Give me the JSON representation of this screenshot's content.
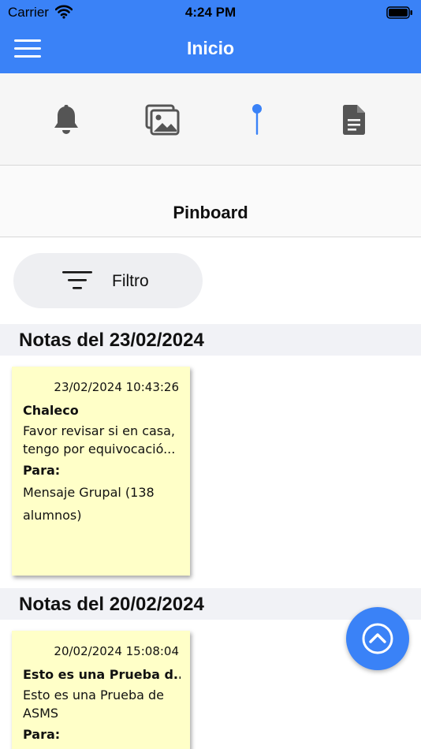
{
  "status_bar": {
    "carrier": "Carrier",
    "time": "4:24 PM",
    "wifi_icon": "wifi-icon",
    "battery_icon": "battery-icon"
  },
  "nav": {
    "title": "Inicio",
    "menu_icon": "hamburger-menu-icon",
    "color": "#3a82f7"
  },
  "tabs": [
    {
      "icon": "bell-icon",
      "active": false
    },
    {
      "icon": "gallery-icon",
      "active": false
    },
    {
      "icon": "pin-icon",
      "active": true
    },
    {
      "icon": "document-icon",
      "active": false
    }
  ],
  "section": {
    "title": "Pinboard"
  },
  "filter": {
    "label": "Filtro",
    "icon": "filter-icon"
  },
  "groups": [
    {
      "header": "Notas del 23/02/2024",
      "notes": [
        {
          "timestamp": "23/02/2024 10:43:26",
          "subject": "Chaleco",
          "body": "Favor revisar si en casa, tengo por equivocació...",
          "para_label": "Para:",
          "recipient": "Mensaje Grupal (138 alumnos)"
        }
      ]
    },
    {
      "header": "Notas del 20/02/2024",
      "notes": [
        {
          "timestamp": "20/02/2024 15:08:04",
          "subject": "Esto es una Prueba d...",
          "body": "Esto es una Prueba de ASMS",
          "para_label": "Para:"
        }
      ]
    }
  ],
  "fab": {
    "icon": "chevron-up-circle-icon"
  },
  "colors": {
    "accent": "#3a82f7",
    "note_background": "#ffffc8",
    "icon_gray": "#555555"
  }
}
